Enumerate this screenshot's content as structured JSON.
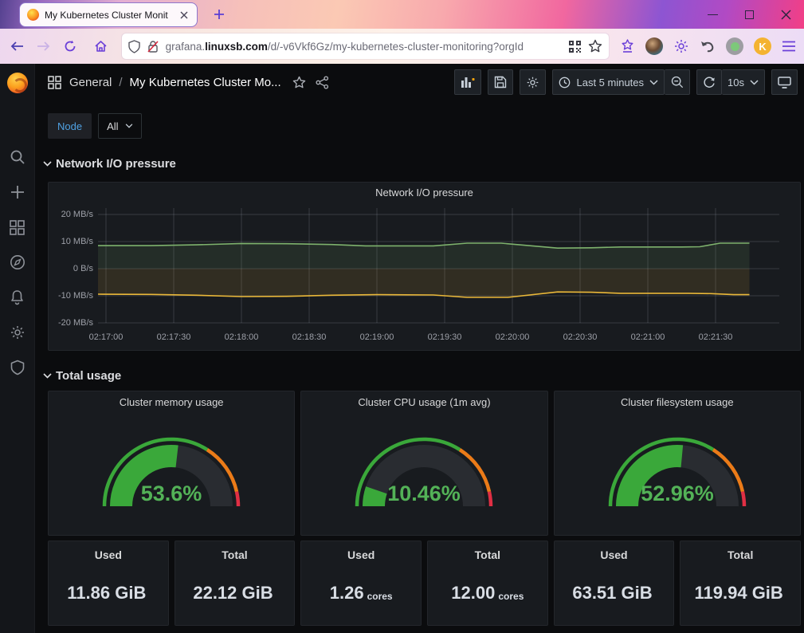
{
  "browser": {
    "tab_title": "My Kubernetes Cluster Monit",
    "url_prefix": "grafana.",
    "url_domain": "linuxsb.com",
    "url_path": "/d/-v6Vkf6Gz/my-kubernetes-cluster-monitoring?orgId",
    "extension_badge": "K"
  },
  "grafana": {
    "breadcrumb": {
      "section": "General",
      "separator": "/",
      "title": "My Kubernetes Cluster Mo..."
    },
    "toolbar": {
      "time_range": "Last 5 minutes",
      "refresh_interval": "10s"
    },
    "variables": {
      "label": "Node",
      "value": "All"
    },
    "rows": {
      "network": {
        "title": "Network I/O pressure"
      },
      "total": {
        "title": "Total usage"
      }
    }
  },
  "chart_data": {
    "type": "area",
    "title": "Network I/O pressure",
    "ylabel": "",
    "xlabel": "",
    "ylim": [
      -20,
      20
    ],
    "grid": true,
    "y_ticks": [
      "20 MB/s",
      "10 MB/s",
      "0 B/s",
      "-10 MB/s",
      "-20 MB/s"
    ],
    "y_values": [
      20,
      10,
      0,
      -10,
      -20
    ],
    "x_ticks": [
      "02:17:00",
      "02:17:30",
      "02:18:00",
      "02:18:30",
      "02:19:00",
      "02:19:30",
      "02:20:00",
      "02:20:30",
      "02:21:00",
      "02:21:30"
    ],
    "x_tick_seconds": [
      0,
      30,
      60,
      90,
      120,
      150,
      180,
      210,
      240,
      270
    ],
    "unit": "MB/s",
    "series": [
      {
        "color": "#7eb26d",
        "points": [
          [
            -4,
            8.5
          ],
          [
            20,
            8.5
          ],
          [
            40,
            8.8
          ],
          [
            60,
            9.3
          ],
          [
            80,
            9.2
          ],
          [
            100,
            8.9
          ],
          [
            115,
            8.4
          ],
          [
            145,
            8.4
          ],
          [
            160,
            9.4
          ],
          [
            175,
            9.4
          ],
          [
            200,
            7.6
          ],
          [
            215,
            7.7
          ],
          [
            228,
            8.0
          ],
          [
            255,
            8.0
          ],
          [
            263,
            8.1
          ],
          [
            272,
            9.4
          ],
          [
            285,
            9.4
          ]
        ]
      },
      {
        "color": "#eab839",
        "points": [
          [
            -4,
            -9.4
          ],
          [
            20,
            -9.5
          ],
          [
            40,
            -9.8
          ],
          [
            60,
            -10.3
          ],
          [
            80,
            -10.2
          ],
          [
            100,
            -9.8
          ],
          [
            120,
            -9.6
          ],
          [
            145,
            -9.7
          ],
          [
            160,
            -10.6
          ],
          [
            178,
            -10.6
          ],
          [
            200,
            -8.6
          ],
          [
            215,
            -8.7
          ],
          [
            228,
            -9.1
          ],
          [
            258,
            -9.1
          ],
          [
            268,
            -9.2
          ],
          [
            278,
            -9.6
          ],
          [
            285,
            -9.6
          ]
        ]
      }
    ]
  },
  "gauges": [
    {
      "title": "Cluster memory usage",
      "value": "53.6%",
      "percent": 53.6,
      "color": "#3aa83a",
      "thresholds": [
        {
          "color": "#3aa83a",
          "upTo": 68
        },
        {
          "color": "#eb7b18",
          "upTo": 93
        },
        {
          "color": "#e02f44",
          "upTo": 100
        }
      ]
    },
    {
      "title": "Cluster CPU usage (1m avg)",
      "value": "10.46%",
      "percent": 10.46,
      "color": "#3aa83a",
      "thresholds": [
        {
          "color": "#3aa83a",
          "upTo": 68
        },
        {
          "color": "#eb7b18",
          "upTo": 93
        },
        {
          "color": "#e02f44",
          "upTo": 100
        }
      ]
    },
    {
      "title": "Cluster filesystem usage",
      "value": "52.96%",
      "percent": 52.96,
      "color": "#3aa83a",
      "thresholds": [
        {
          "color": "#3aa83a",
          "upTo": 68
        },
        {
          "color": "#eb7b18",
          "upTo": 93
        },
        {
          "color": "#e02f44",
          "upTo": 100
        }
      ]
    }
  ],
  "stats": [
    {
      "label": "Used",
      "value": "11.86 GiB",
      "suffix": ""
    },
    {
      "label": "Total",
      "value": "22.12 GiB",
      "suffix": ""
    },
    {
      "label": "Used",
      "value": "1.26",
      "suffix": "cores"
    },
    {
      "label": "Total",
      "value": "12.00",
      "suffix": "cores"
    },
    {
      "label": "Used",
      "value": "63.51 GiB",
      "suffix": ""
    },
    {
      "label": "Total",
      "value": "119.94 GiB",
      "suffix": ""
    }
  ]
}
